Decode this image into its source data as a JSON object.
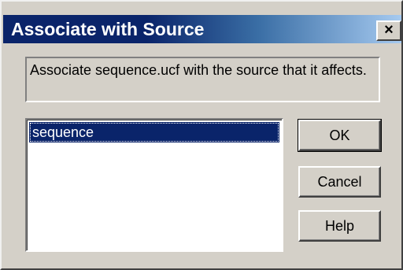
{
  "window": {
    "title": "Associate with Source",
    "close_icon": "close-icon",
    "close_glyph": "×"
  },
  "message": "Associate sequence.ucf with the source that it affects.",
  "list": {
    "items": [
      {
        "label": "sequence",
        "selected": true
      }
    ]
  },
  "buttons": {
    "ok_label": "OK",
    "cancel_label": "Cancel",
    "help_label": "Help"
  },
  "colors": {
    "face": "#d4d0c8",
    "title_active": "#0a246a",
    "title_gradient_end": "#a6caf0",
    "selection": "#0a246a"
  }
}
